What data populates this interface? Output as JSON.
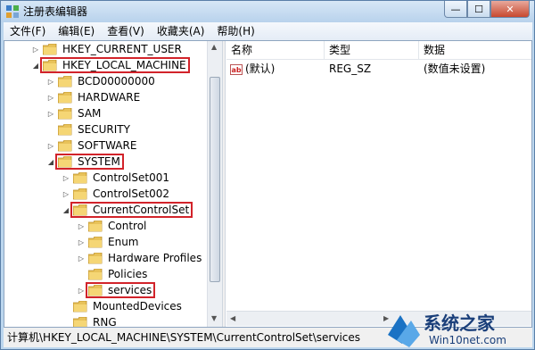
{
  "window": {
    "title": "注册表编辑器",
    "min": "—",
    "max": "☐",
    "close": "✕"
  },
  "menu": [
    "文件(F)",
    "编辑(E)",
    "查看(V)",
    "收藏夹(A)",
    "帮助(H)"
  ],
  "tree": [
    {
      "label": "HKEY_CURRENT_USER",
      "level": 0,
      "exp": "▷",
      "hl": false
    },
    {
      "label": "HKEY_LOCAL_MACHINE",
      "level": 0,
      "exp": "◢",
      "hl": true
    },
    {
      "label": "BCD00000000",
      "level": 1,
      "exp": "▷",
      "hl": false
    },
    {
      "label": "HARDWARE",
      "level": 1,
      "exp": "▷",
      "hl": false
    },
    {
      "label": "SAM",
      "level": 1,
      "exp": "▷",
      "hl": false
    },
    {
      "label": "SECURITY",
      "level": 1,
      "exp": "",
      "hl": false
    },
    {
      "label": "SOFTWARE",
      "level": 1,
      "exp": "▷",
      "hl": false
    },
    {
      "label": "SYSTEM",
      "level": 1,
      "exp": "◢",
      "hl": true
    },
    {
      "label": "ControlSet001",
      "level": 2,
      "exp": "▷",
      "hl": false
    },
    {
      "label": "ControlSet002",
      "level": 2,
      "exp": "▷",
      "hl": false
    },
    {
      "label": "CurrentControlSet",
      "level": 2,
      "exp": "◢",
      "hl": true
    },
    {
      "label": "Control",
      "level": 3,
      "exp": "▷",
      "hl": false
    },
    {
      "label": "Enum",
      "level": 3,
      "exp": "▷",
      "hl": false
    },
    {
      "label": "Hardware Profiles",
      "level": 3,
      "exp": "▷",
      "hl": false
    },
    {
      "label": "Policies",
      "level": 3,
      "exp": "",
      "hl": false
    },
    {
      "label": "services",
      "level": 3,
      "exp": "▷",
      "hl": true
    },
    {
      "label": "MountedDevices",
      "level": 2,
      "exp": "",
      "hl": false
    },
    {
      "label": "RNG",
      "level": 2,
      "exp": "",
      "hl": false
    }
  ],
  "columns": {
    "name": "名称",
    "type": "类型",
    "data": "数据"
  },
  "values": [
    {
      "name": "(默认)",
      "type": "REG_SZ",
      "data": "(数值未设置)",
      "icon": "ab"
    }
  ],
  "status": "计算机\\HKEY_LOCAL_MACHINE\\SYSTEM\\CurrentControlSet\\services",
  "watermark": {
    "cn": "系统之家",
    "en": "Win10net.com"
  },
  "colors": {
    "highlight": "#d2232a",
    "folder": "#e8c25a"
  }
}
